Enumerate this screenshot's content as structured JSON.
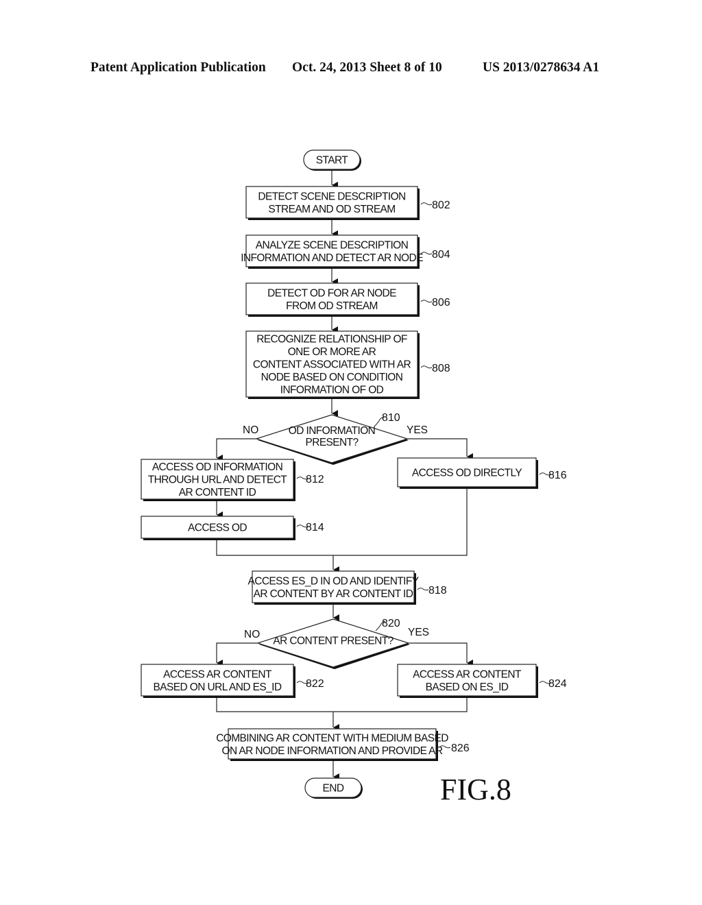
{
  "header": {
    "publication": "Patent Application Publication",
    "date_sheet": "Oct. 24, 2013   Sheet 8 of 10",
    "patent_number": "US 2013/0278634 A1"
  },
  "figure_label": "FIG.8",
  "flowchart": {
    "start": "START",
    "end": "END",
    "steps": [
      {
        "id": "802",
        "lines": [
          "DETECT SCENE DESCRIPTION",
          "STREAM AND OD STREAM"
        ]
      },
      {
        "id": "804",
        "lines": [
          "ANALYZE SCENE DESCRIPTION",
          "INFORMATION AND DETECT AR NODE"
        ]
      },
      {
        "id": "806",
        "lines": [
          "DETECT OD FOR AR NODE",
          "FROM OD STREAM"
        ]
      },
      {
        "id": "808",
        "lines": [
          "RECOGNIZE RELATIONSHIP OF",
          "ONE OR MORE AR",
          "CONTENT ASSOCIATED WITH AR",
          "NODE BASED ON CONDITION",
          "INFORMATION OF OD"
        ]
      },
      {
        "id": "812",
        "lines": [
          "ACCESS OD INFORMATION",
          "THROUGH URL AND DETECT",
          "AR CONTENT ID"
        ]
      },
      {
        "id": "814",
        "lines": [
          "ACCESS OD"
        ]
      },
      {
        "id": "816",
        "lines": [
          "ACCESS OD DIRECTLY"
        ]
      },
      {
        "id": "818",
        "lines": [
          "ACCESS ES_D IN OD AND IDENTIFY",
          "AR CONTENT BY AR CONTENT ID"
        ]
      },
      {
        "id": "822",
        "lines": [
          "ACCESS AR CONTENT",
          "BASED ON URL AND ES_ID"
        ]
      },
      {
        "id": "824",
        "lines": [
          "ACCESS AR CONTENT",
          "BASED ON ES_ID"
        ]
      },
      {
        "id": "826",
        "lines": [
          "COMBINING AR CONTENT WITH MEDIUM BASED",
          "ON AR NODE INFORMATION AND PROVIDE AR"
        ]
      }
    ],
    "decisions": [
      {
        "id": "810",
        "lines": [
          "OD INFORMATION",
          "PRESENT?"
        ],
        "no_label": "NO",
        "yes_label": "YES"
      },
      {
        "id": "820",
        "lines": [
          "AR CONTENT PRESENT?"
        ],
        "no_label": "NO",
        "yes_label": "YES"
      }
    ]
  }
}
